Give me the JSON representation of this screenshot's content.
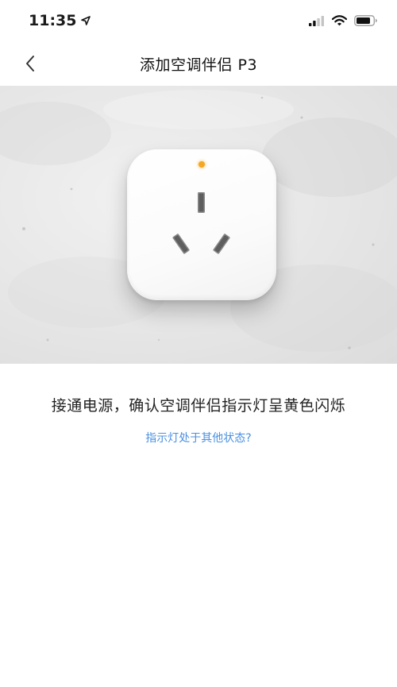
{
  "status_bar": {
    "time": "11:35",
    "icons": [
      "location-arrow-icon",
      "cellular-signal-icon",
      "wifi-icon",
      "battery-icon"
    ]
  },
  "nav": {
    "title": "添加空调伴侣 P3",
    "back_icon": "chevron-left-icon"
  },
  "hero": {
    "device": "smart-plug",
    "led_color": "#f5a623"
  },
  "instruction": {
    "text": "接通电源，确认空调伴侣指示灯呈黄色闪烁",
    "link": "指示灯处于其他状态?"
  },
  "colors": {
    "link": "#4a90e2",
    "led": "#f5a623"
  }
}
